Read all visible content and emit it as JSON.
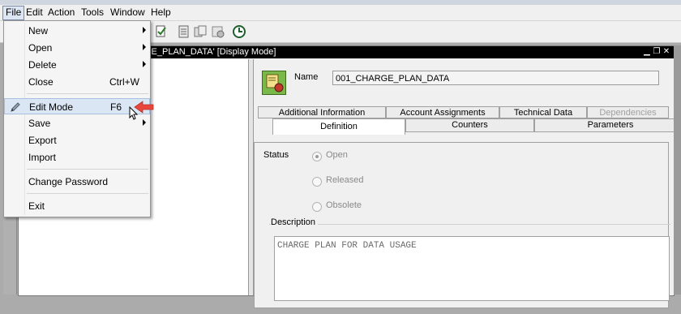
{
  "menu": {
    "file": "File",
    "edit": "Edit",
    "action": "Action",
    "tools": "Tools",
    "window": "Window",
    "help": "Help"
  },
  "inner_window": {
    "title": "GE_PLAN_DATA' [Display Mode]"
  },
  "object": {
    "name_label": "Name",
    "name_value": "001_CHARGE_PLAN_DATA"
  },
  "tabs": {
    "row1": [
      "Additional Information",
      "Account Assignments",
      "Technical Data",
      "Dependencies"
    ],
    "row2": [
      "Definition",
      "Counters",
      "Parameters"
    ]
  },
  "definition": {
    "status_label": "Status",
    "status_options": [
      "Open",
      "Released",
      "Obsolete"
    ],
    "selected_status": "Open",
    "description_label": "Description",
    "description_value": "CHARGE PLAN FOR DATA USAGE"
  },
  "file_menu": {
    "items": [
      {
        "label": "New",
        "shortcut": "",
        "submenu": true
      },
      {
        "label": "Open",
        "shortcut": "",
        "submenu": true
      },
      {
        "label": "Delete",
        "shortcut": "",
        "submenu": true
      },
      {
        "label": "Close",
        "shortcut": "Ctrl+W",
        "submenu": false
      },
      {
        "label": "Edit Mode",
        "shortcut": "F6",
        "submenu": false
      },
      {
        "label": "Save",
        "shortcut": "",
        "submenu": true
      },
      {
        "label": "Export",
        "shortcut": "",
        "submenu": false
      },
      {
        "label": "Import",
        "shortcut": "",
        "submenu": false
      },
      {
        "label": "Change Password",
        "shortcut": "",
        "submenu": false
      },
      {
        "label": "Exit",
        "shortcut": "",
        "submenu": false
      }
    ],
    "highlighted": "Edit Mode"
  },
  "colors": {
    "annotation_arrow": "#e8463c",
    "menu_highlight": "#dbe6f5",
    "inner_title_bg": "#000000"
  }
}
